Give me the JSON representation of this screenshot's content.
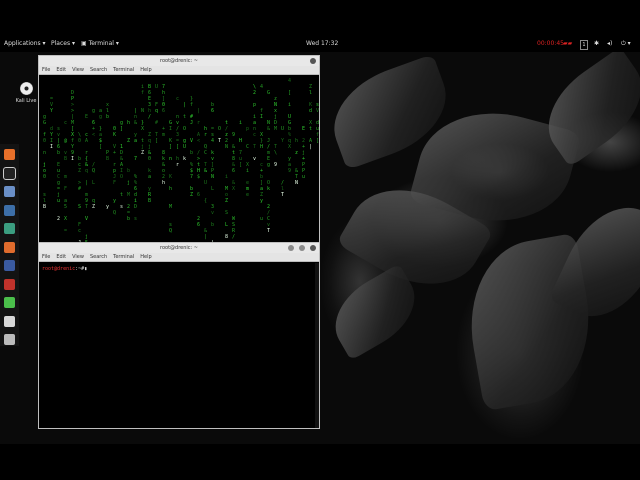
{
  "panel": {
    "applications": "Applications ▾",
    "places": "Places ▾",
    "active_app": "▣ Terminal ▾",
    "clock": "Wed 17:32",
    "recording_timer": "00:00:45",
    "workspace": "1"
  },
  "desktop": {
    "icon_label": "Kali Live"
  },
  "dock": {
    "items": [
      {
        "icon": "firefox-icon",
        "color": "#e8702a"
      },
      {
        "icon": "terminal-icon",
        "color": "#222222"
      },
      {
        "icon": "files-icon",
        "color": "#6a8fc7"
      },
      {
        "icon": "metasploit-icon",
        "color": "#3d6fa8"
      },
      {
        "icon": "armitage-icon",
        "color": "#3b9e80"
      },
      {
        "icon": "burpsuite-icon",
        "color": "#e06c2d"
      },
      {
        "icon": "maltego-icon",
        "color": "#3a5aa0"
      },
      {
        "icon": "beef-icon",
        "color": "#c0322b"
      },
      {
        "icon": "faraday-icon",
        "color": "#4bbf4b"
      },
      {
        "icon": "leafpad-icon",
        "color": "#d8d8d8"
      },
      {
        "icon": "show-apps-icon",
        "color": "#bbbbbb"
      }
    ]
  },
  "windows": {
    "matrix": {
      "title": "root@drenic: ~",
      "menu": [
        "File",
        "Edit",
        "View",
        "Search",
        "Terminal",
        "Help"
      ]
    },
    "shell": {
      "title": "root@drenic: ~",
      "menu": [
        "File",
        "Edit",
        "View",
        "Search",
        "Terminal",
        "Help"
      ],
      "prompt_user": "root@drenic",
      "prompt_rest": ":~#"
    }
  },
  "colors": {
    "matrix_green": "#33dd33",
    "prompt_red": "#ee3333"
  }
}
